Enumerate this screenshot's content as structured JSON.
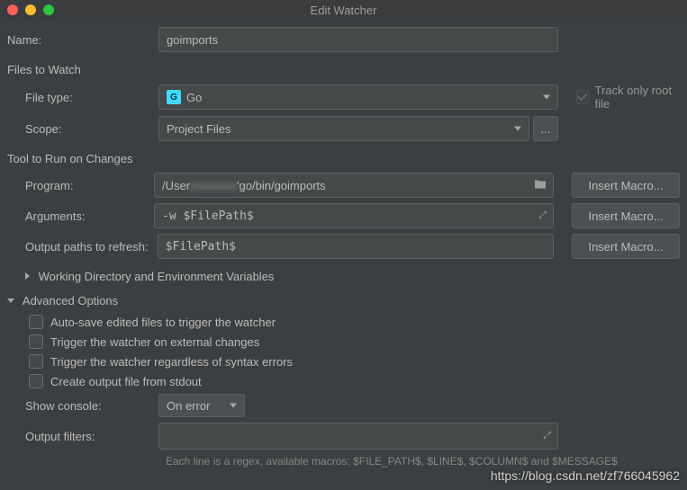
{
  "window": {
    "title": "Edit Watcher"
  },
  "labels": {
    "name": "Name:",
    "filesToWatch": "Files to Watch",
    "fileType": "File type:",
    "scope": "Scope:",
    "trackOnlyRoot": "Track only root file",
    "toolToRun": "Tool to Run on Changes",
    "program": "Program:",
    "arguments": "Arguments:",
    "outputPaths": "Output paths to refresh:",
    "workingDirEnv": "Working Directory and Environment Variables",
    "advancedOptions": "Advanced Options",
    "autoSave": "Auto-save edited files to trigger the watcher",
    "externalChanges": "Trigger the watcher on external changes",
    "regardlessSyntax": "Trigger the watcher regardless of syntax errors",
    "createOutputStdout": "Create output file from stdout",
    "showConsole": "Show console:",
    "outputFilters": "Output filters:",
    "insertMacro": "Insert Macro...",
    "hint": "Each line is a regex, available macros: $FILE_PATH$, $LINE$, $COLUMN$ and $MESSAGE$"
  },
  "values": {
    "name": "goimports",
    "fileType": "Go",
    "scope": "Project Files",
    "programPre": "/User",
    "programMid": "xxxxxxxx",
    "programPost": "'go/bin/goimports",
    "arguments": "-w $FilePath$",
    "outputPaths": "$FilePath$",
    "showConsole": "On error",
    "outputFilters": ""
  },
  "watermark": "https://blog.csdn.net/zf766045962"
}
